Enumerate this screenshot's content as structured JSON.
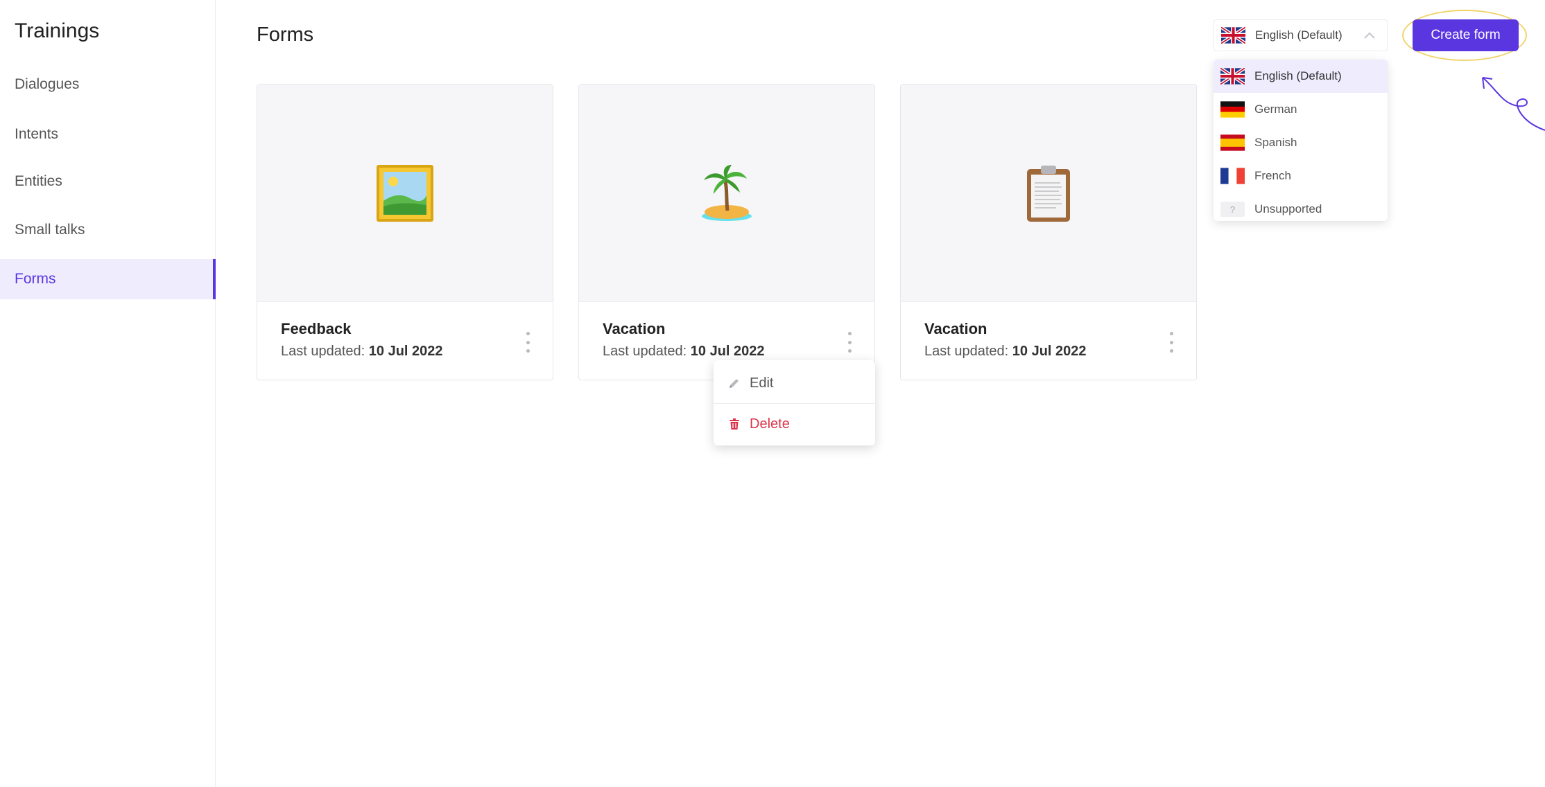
{
  "sidebar": {
    "title": "Trainings",
    "items": [
      {
        "label": "Dialogues"
      },
      {
        "label": "Intents"
      },
      {
        "label": "Entities"
      },
      {
        "label": "Small talks"
      },
      {
        "label": "Forms",
        "active": true
      }
    ]
  },
  "header": {
    "title": "Forms",
    "language_select": {
      "value": "English (Default)",
      "icon": "uk-flag-icon"
    },
    "create_button": "Create form"
  },
  "language_menu": {
    "options": [
      {
        "label": "English (Default)",
        "icon": "uk-flag-icon",
        "selected": true
      },
      {
        "label": "German",
        "icon": "germany-flag-icon"
      },
      {
        "label": "Spanish",
        "icon": "spain-flag-icon"
      },
      {
        "label": "French",
        "icon": "france-flag-icon"
      },
      {
        "label": "Unsupported",
        "icon": "unknown-flag-icon",
        "icon_text": "?"
      }
    ]
  },
  "cards": [
    {
      "title": "Feedback",
      "updated_label": "Last updated:",
      "updated_date": "10 Jul 2022",
      "icon": "framed-picture-icon"
    },
    {
      "title": "Vacation",
      "updated_label": "Last updated:",
      "updated_date": "10 Jul 2022",
      "icon": "desert-island-icon"
    },
    {
      "title": "Vacation",
      "updated_label": "Last updated:",
      "updated_date": "10 Jul 2022",
      "icon": "clipboard-icon"
    }
  ],
  "context_menu": {
    "edit": "Edit",
    "delete": "Delete"
  },
  "colors": {
    "accent": "#5a36e0",
    "accent_light": "#efecfd",
    "danger": "#d9364b",
    "highlight": "#f1d46a"
  }
}
